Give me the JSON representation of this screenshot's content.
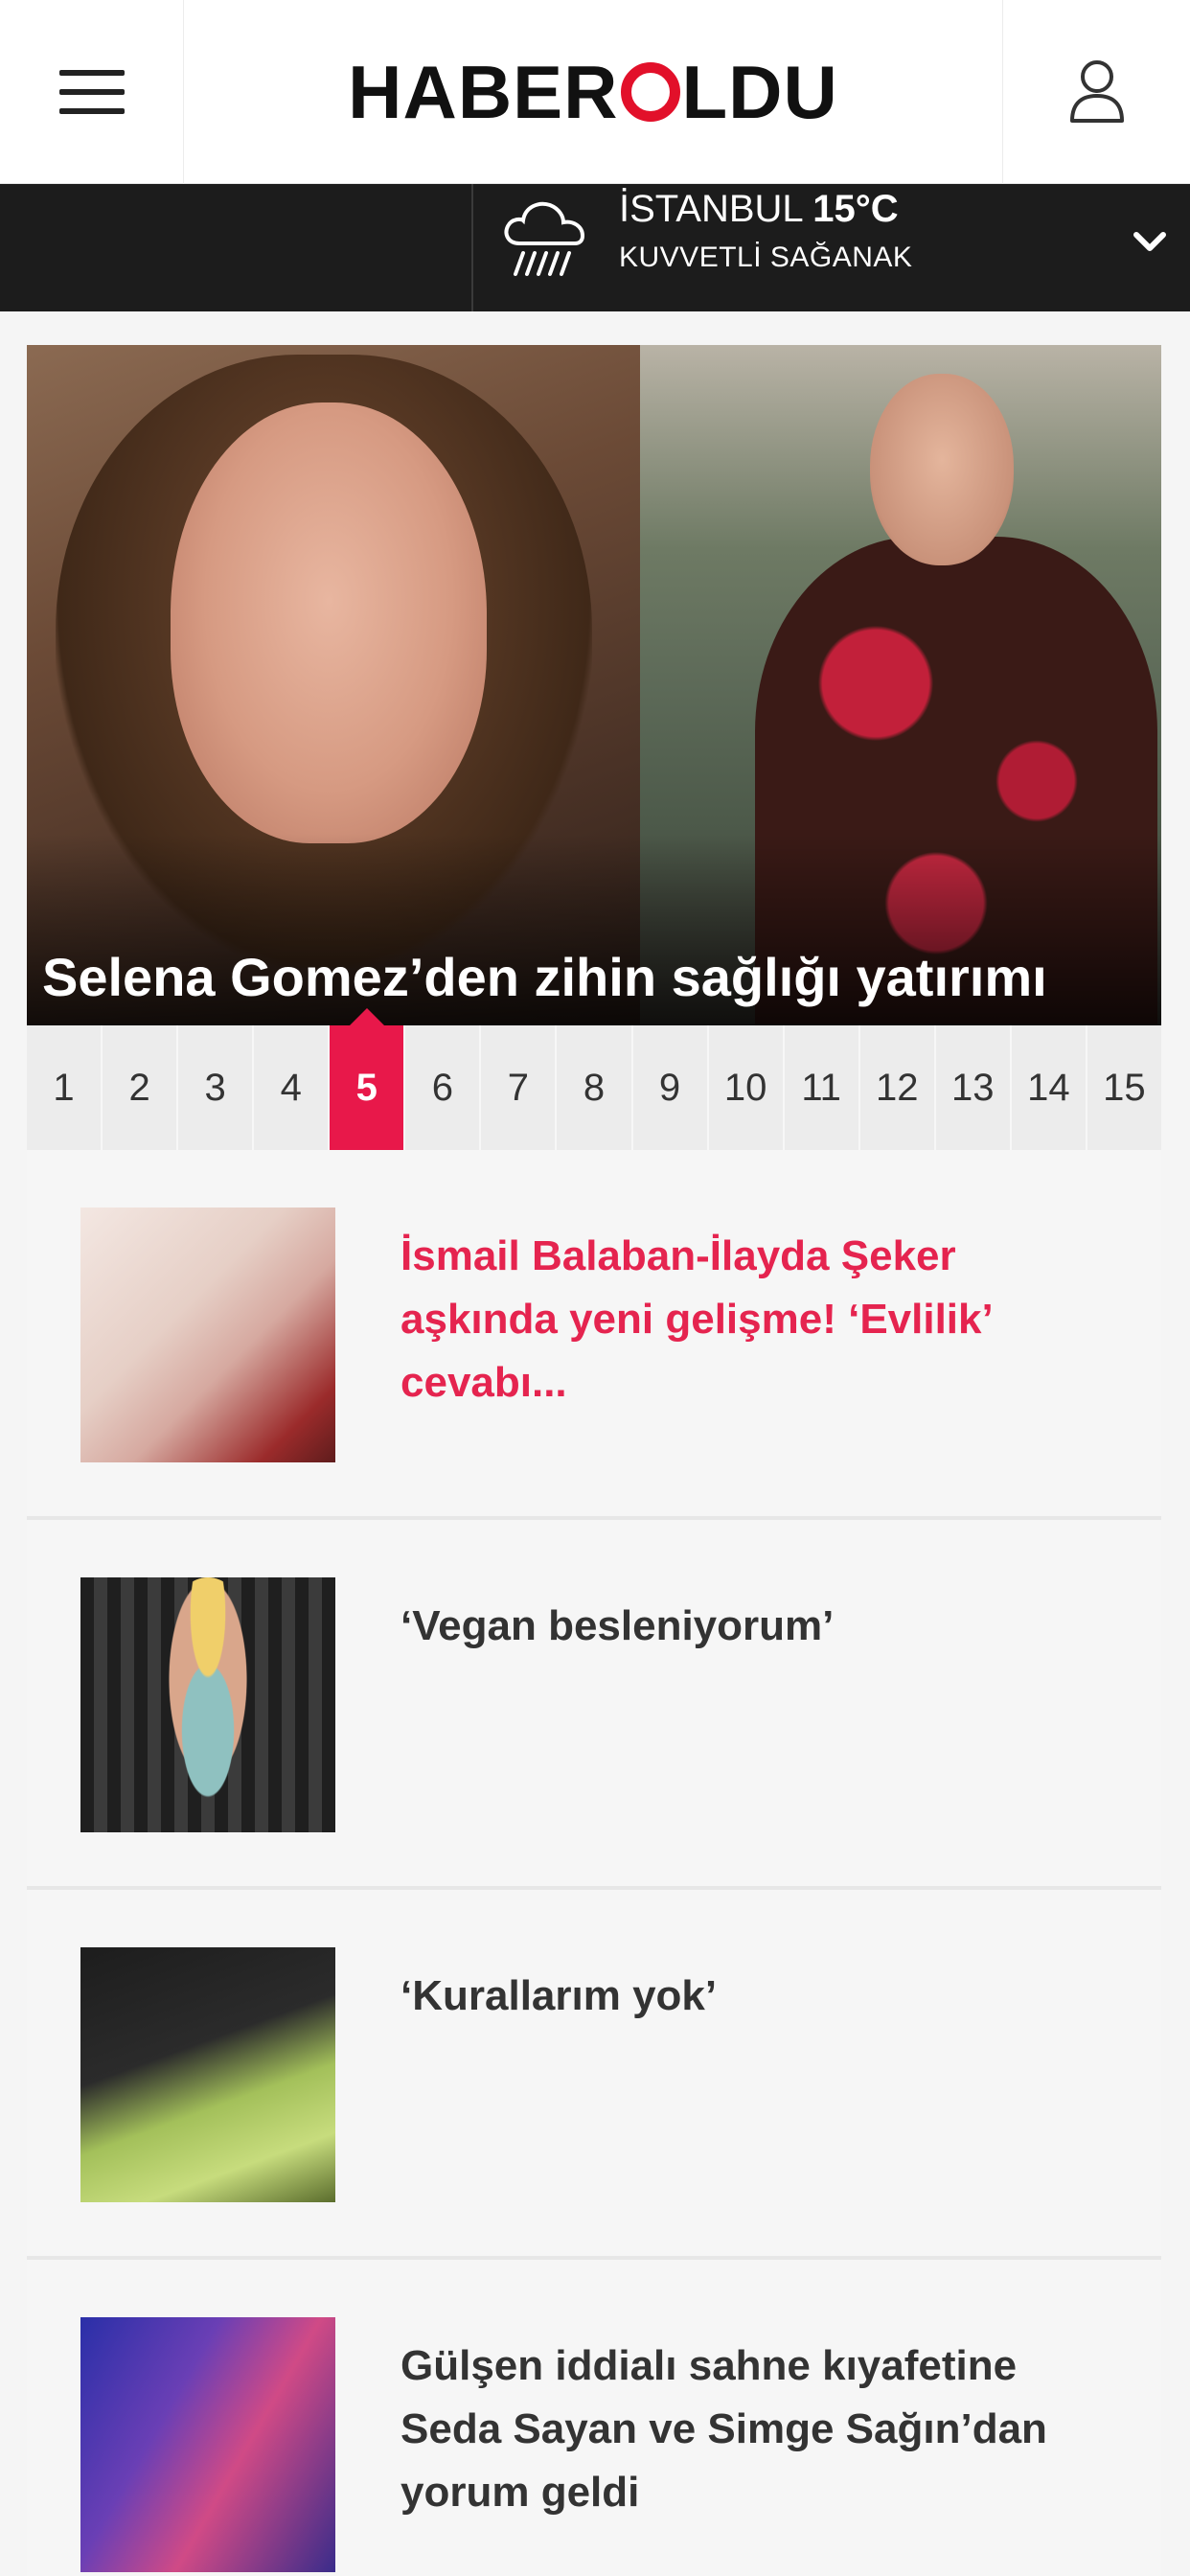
{
  "header": {
    "logo_left": "HABER",
    "logo_right": "LDU",
    "menu_icon": "hamburger-menu-icon",
    "user_icon": "user-profile-icon"
  },
  "weather": {
    "city": "İSTANBUL",
    "temperature": "15°C",
    "condition": "KUVVETLİ SAĞANAK",
    "icon": "rain-cloud-icon"
  },
  "hero": {
    "title": "Selena Gomez’den zihin sağlığı yatırımı"
  },
  "pager": {
    "pages": [
      "1",
      "2",
      "3",
      "4",
      "5",
      "6",
      "7",
      "8",
      "9",
      "10",
      "11",
      "12",
      "13",
      "14",
      "15"
    ],
    "active_page": "5"
  },
  "news": [
    {
      "headline": "İsmail Balaban-İlayda Şeker aşkında yeni gelişme! ‘Evlilik’ cevabı..."
    },
    {
      "headline": "‘Vegan besleniyorum’"
    },
    {
      "headline": "‘Kurallarım yok’"
    },
    {
      "headline": "Gülşen iddialı sahne kıyafetine Seda Sayan ve Simge Sağın’dan yorum geldi"
    }
  ],
  "colors": {
    "accent": "#e8184a",
    "headline_active": "#e5244f",
    "weather_bar": "#1c1c1c",
    "logo_o": "#e2102a"
  }
}
